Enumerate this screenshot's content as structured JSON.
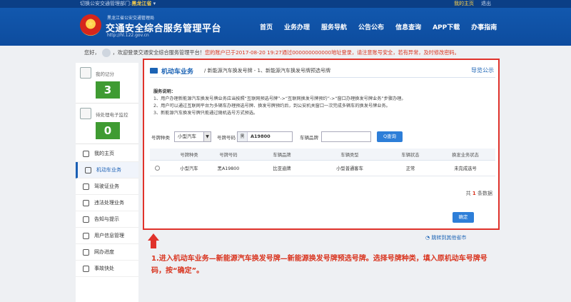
{
  "topbar": {
    "switch_label": "切换公安交通管理部门:",
    "province": "黑龙江省",
    "my_home": "我的主页",
    "logout": "退出"
  },
  "header": {
    "org": "黑龙江省公安交通管理局",
    "title": "交通安全综合服务管理平台",
    "url": "http://hl.122.gov.cn",
    "nav": [
      "首页",
      "业务办理",
      "服务导航",
      "公告公布",
      "信息查询",
      "APP下载",
      "办事指南"
    ]
  },
  "welcome": {
    "prefix": "您好，",
    "text": "，欢迎登录交通安全综合服务管理平台！",
    "warning": "您的账户已于2017-08-20 19:27通过000000000000地址登录，请注意账号安全，若有异常，及时修改密码。"
  },
  "sidebar": {
    "score_label": "我的记分",
    "score_value": "3",
    "monitor_label": "待处理电子监控",
    "monitor_value": "0",
    "menu": [
      "我的主页",
      "机动车业务",
      "驾驶证业务",
      "违法处理业务",
      "告知与提示",
      "用户信息管理",
      "网办进度",
      "事故快处"
    ]
  },
  "panel": {
    "section": "机动车业务",
    "crumb": "/ 新能源汽车换发号牌 - 1、新能源汽车换发号牌预选号牌",
    "notice": "导览公示",
    "desc_title": "服务说明：",
    "desc_lines": [
      "1、用户办理新能源汽车换发号牌业务应当按照“互联网预选号牌”->“互联网换发号牌预约”->“窗口办理换发号牌业务”步骤办理。",
      "2、用户可以通过互联网平台为多辆车办理预选号牌、换发号牌预约后，到公安机关窗口一次完成多辆车的换发号牌业务。",
      "3、新能源汽车换发号牌只能通过随机选号方式预选。"
    ],
    "form": {
      "plate_type_label": "号牌种类",
      "plate_type_value": "小型汽车",
      "plate_no_label": "号牌号码",
      "plate_prefix": "黑",
      "plate_no_value": "A19800",
      "brand_label": "车辆品牌",
      "brand_placeholder": "",
      "search_label": "Q查询"
    },
    "table": {
      "headers": [
        "号牌种类",
        "号牌号码",
        "车辆品牌",
        "车辆类型",
        "车辆状态",
        "换发业务状态"
      ],
      "rows": [
        [
          "小型汽车",
          "黑A19800",
          "比亚迪牌",
          "小型普通客车",
          "正常",
          "未完成选号"
        ]
      ]
    },
    "total_prefix": "共",
    "total_count": "1",
    "total_suffix": "条数据",
    "confirm_label": "确定"
  },
  "jump_label": "跳转到其他省市",
  "instruction": "1.进入机动车业务—新能源汽车换发号牌—新能源换发号牌预选号牌。选择号牌种类，填入原机动车号牌号码，按“确定”。",
  "colors": {
    "header_blue": "#1258ae",
    "accent_blue": "#1b63b5",
    "highlight_red": "#e0322b",
    "badge_green": "#3f9b32"
  }
}
